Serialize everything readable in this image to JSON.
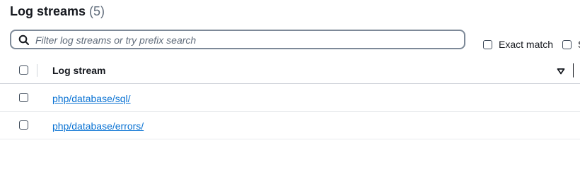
{
  "header": {
    "title": "Log streams",
    "count": "(5)"
  },
  "search": {
    "placeholder": "Filter log streams or try prefix search",
    "value": "",
    "icon": "search-icon"
  },
  "options": {
    "exact_match_label": "Exact match",
    "second_label": "S"
  },
  "table": {
    "column_header": "Log stream",
    "sort_icon": "sort-descending-icon",
    "rows": [
      {
        "name": "php/database/sql/"
      },
      {
        "name": "php/database/errors/"
      }
    ]
  },
  "colors": {
    "link": "#0972d3",
    "text": "#16191f",
    "muted": "#5f6b7a",
    "border": "#7d8998"
  }
}
